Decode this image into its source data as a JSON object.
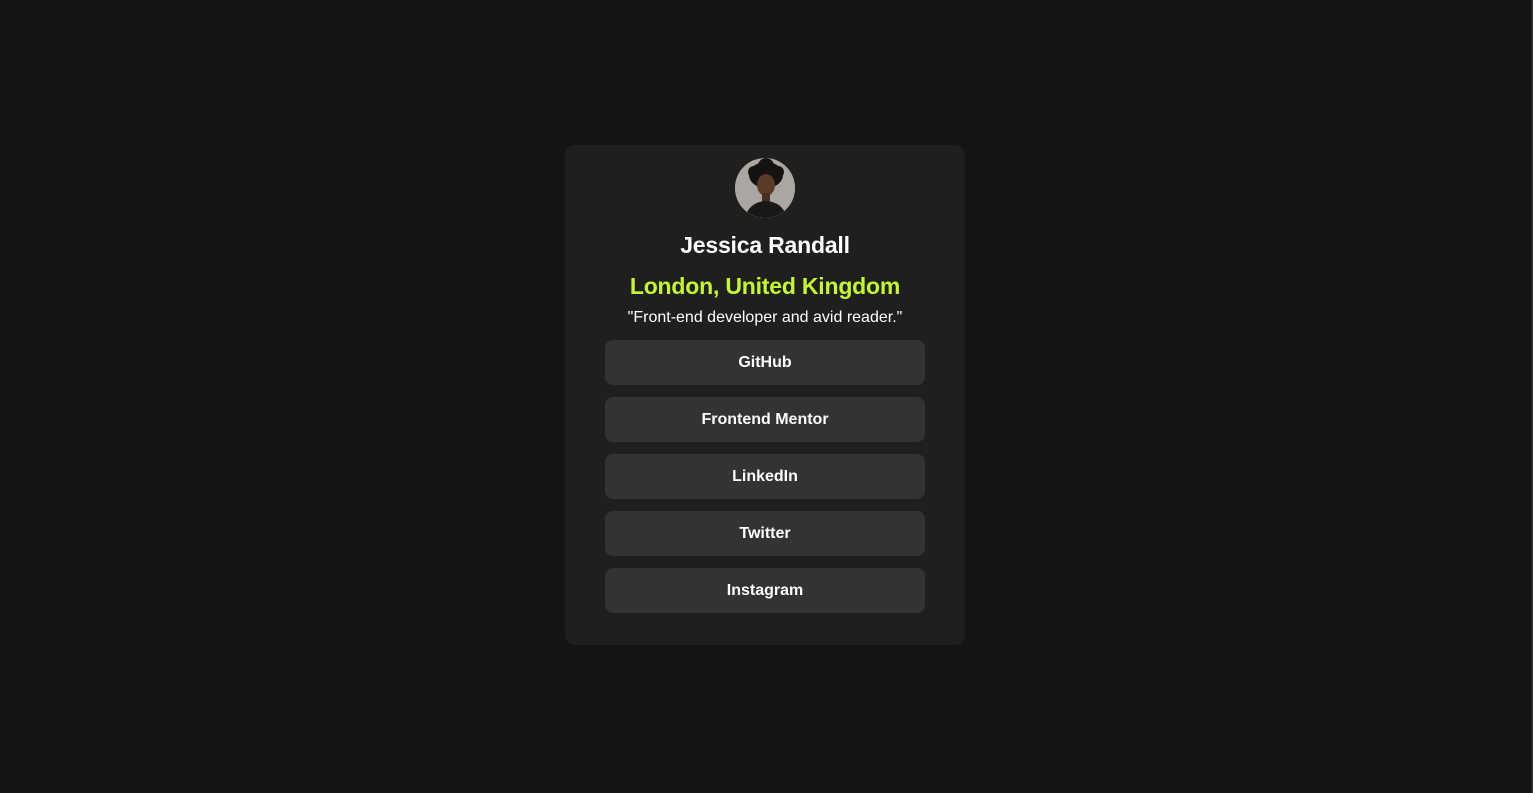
{
  "profile": {
    "avatar_icon": "profile-photo",
    "name": "Jessica Randall",
    "location": "London, United Kingdom",
    "bio": "\"Front-end developer and avid reader.\""
  },
  "links": [
    {
      "label": "GitHub"
    },
    {
      "label": "Frontend Mentor"
    },
    {
      "label": "LinkedIn"
    },
    {
      "label": "Twitter"
    },
    {
      "label": "Instagram"
    }
  ],
  "colors": {
    "page_background": "#141414",
    "card_background": "#1f1f1f",
    "button_background": "#333333",
    "accent": "#c4f82a",
    "text": "#ffffff"
  }
}
